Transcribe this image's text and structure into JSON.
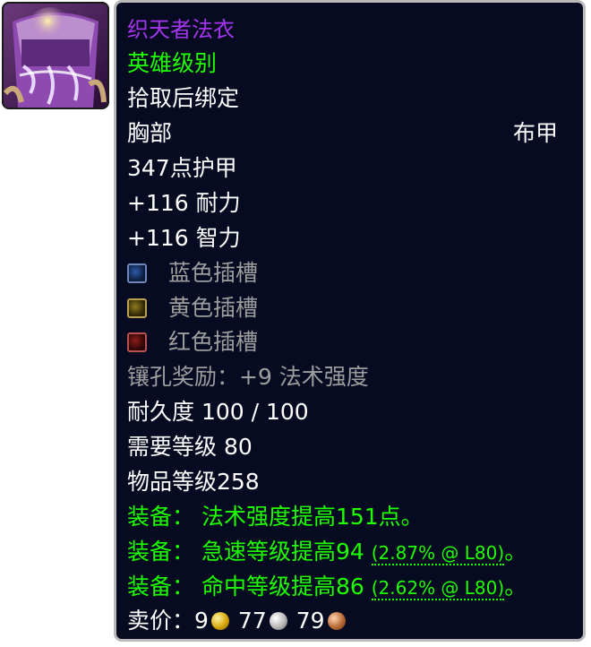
{
  "item": {
    "name": "织天者法衣",
    "quality": "英雄级别",
    "bind": "拾取后绑定",
    "slot": "胸部",
    "armor_type": "布甲",
    "armor": "347点护甲",
    "stats": [
      "+116 耐力",
      "+116 智力"
    ],
    "sockets": [
      {
        "color": "blue",
        "label": "蓝色插槽"
      },
      {
        "color": "yellow",
        "label": "黄色插槽"
      },
      {
        "color": "red",
        "label": "红色插槽"
      }
    ],
    "socket_bonus": "镶孔奖励：+9 法术强度",
    "durability": "耐久度 100 / 100",
    "required_level": "需要等级 80",
    "item_level": "物品等级258",
    "equip_effects": [
      {
        "prefix": "装备：",
        "text": "法术强度提高151点。",
        "note": "",
        "suffix": ""
      },
      {
        "prefix": "装备：",
        "text": "急速等级提高94 ",
        "note": "(2.87% @ L80)",
        "suffix": "。"
      },
      {
        "prefix": "装备：",
        "text": "命中等级提高86 ",
        "note": "(2.62% @ L80)",
        "suffix": "。"
      }
    ],
    "sell_price": {
      "label": "卖价：",
      "gold": "9",
      "silver": "77",
      "copper": "79"
    }
  },
  "colors": {
    "epic": "#a335ee",
    "uncommon": "#1eff00",
    "grey": "#9d9d9d",
    "background": "#070b22",
    "border": "#b9b9b9"
  },
  "icons": {
    "item_icon": "robe-icon",
    "coins": [
      "gold-coin-icon",
      "silver-coin-icon",
      "copper-coin-icon"
    ]
  }
}
